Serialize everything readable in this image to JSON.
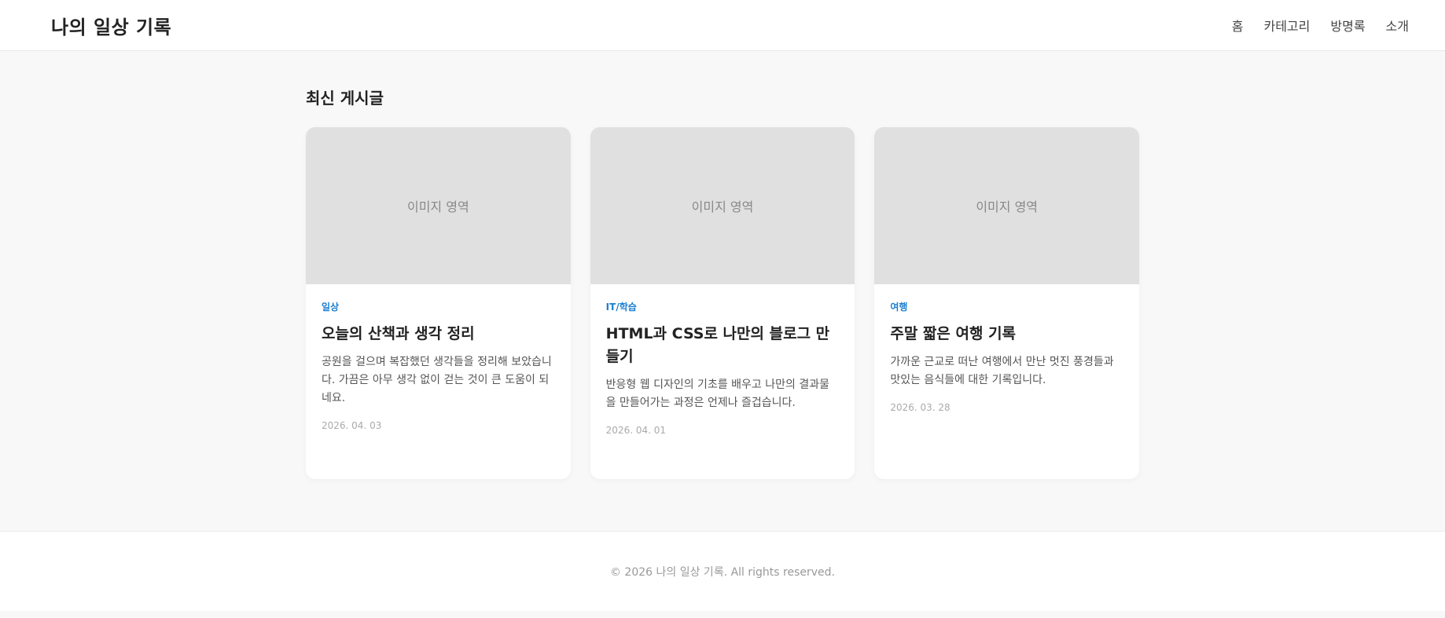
{
  "header": {
    "logo": "나의 일상 기록",
    "nav": [
      "홈",
      "카테고리",
      "방명록",
      "소개"
    ]
  },
  "main": {
    "section_title": "최신 게시글",
    "posts": [
      {
        "image_placeholder": "이미지 영역",
        "category": "일상",
        "title": "오늘의 산책과 생각 정리",
        "excerpt": "공원을 걸으며 복잡했던 생각들을 정리해 보았습니다. 가끔은 아무 생각 없이 걷는 것이 큰 도움이 되네요.",
        "date": "2026. 04. 03"
      },
      {
        "image_placeholder": "이미지 영역",
        "category": "IT/학습",
        "title": "HTML과 CSS로 나만의 블로그 만들기",
        "excerpt": "반응형 웹 디자인의 기초를 배우고 나만의 결과물을 만들어가는 과정은 언제나 즐겁습니다.",
        "date": "2026. 04. 01"
      },
      {
        "image_placeholder": "이미지 영역",
        "category": "여행",
        "title": "주말 짧은 여행 기록",
        "excerpt": "가까운 근교로 떠난 여행에서 만난 멋진 풍경들과 맛있는 음식들에 대한 기록입니다.",
        "date": "2026. 03. 28"
      }
    ]
  },
  "footer": {
    "copyright": "© 2026 나의 일상 기록. All rights reserved."
  },
  "colors": {
    "accent": "#1b7fd1",
    "background": "#f8f8f8",
    "placeholder": "#e0e0e0"
  }
}
